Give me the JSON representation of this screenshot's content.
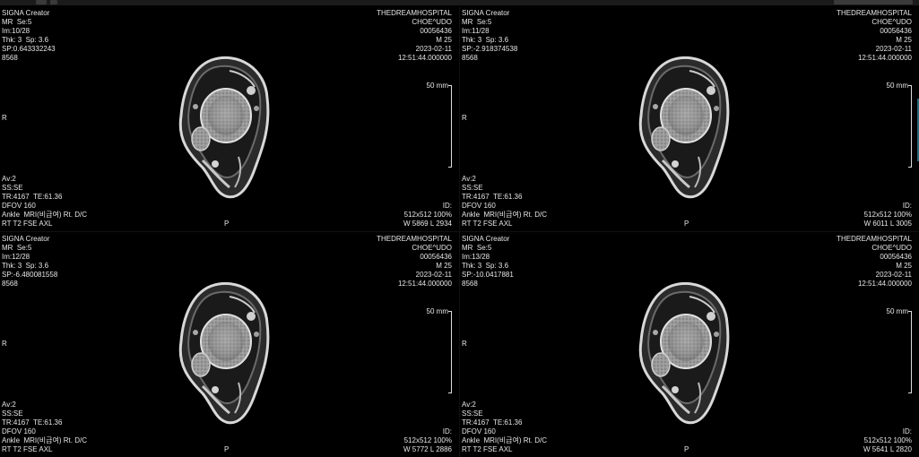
{
  "viewports": [
    {
      "header_left": [
        "SIGNA Creator",
        "MR  Se:5",
        "Im:10/28",
        "Thk: 3  Sp: 3.6",
        "SP:0.643332243",
        "8568"
      ],
      "header_right": [
        "THEDREAMHOSPITAL",
        "CHOE^UDO",
        "00056436",
        "M 25",
        "2023-02-11",
        "12:51:44.000000"
      ],
      "footer_left": [
        "Av:2",
        "SS:SE",
        "TR:4167  TE:61.36",
        "DFOV 160",
        "Ankle  MRI(비급여) Rt. D/C",
        "RT T2 FSE AXL"
      ],
      "footer_right": [
        "ID:",
        "512x512 100%",
        "W 5869 L 2934"
      ],
      "orient_side": "R",
      "orient_bottom": "P",
      "scale_label": "50 mm"
    },
    {
      "header_left": [
        "SIGNA Creator",
        "MR  Se:5",
        "Im:11/28",
        "Thk: 3  Sp: 3.6",
        "SP:-2.918374538",
        "8568"
      ],
      "header_right": [
        "THEDREAMHOSPITAL",
        "CHOE^UDO",
        "00056436",
        "M 25",
        "2023-02-11",
        "12:51:44.000000"
      ],
      "footer_left": [
        "Av:2",
        "SS:SE",
        "TR:4167  TE:61.36",
        "DFOV 160",
        "Ankle  MRI(비급여) Rt. D/C",
        "RT T2 FSE AXL"
      ],
      "footer_right": [
        "ID:",
        "512x512 100%",
        "W 6011 L 3005"
      ],
      "orient_side": "R",
      "orient_bottom": "P",
      "scale_label": "50 mm"
    },
    {
      "header_left": [
        "SIGNA Creator",
        "MR  Se:5",
        "Im:12/28",
        "Thk: 3  Sp: 3.6",
        "SP:-6.480081558",
        "8568"
      ],
      "header_right": [
        "THEDREAMHOSPITAL",
        "CHOE^UDO",
        "00056436",
        "M 25",
        "2023-02-11",
        "12:51:44.000000"
      ],
      "footer_left": [
        "Av:2",
        "SS:SE",
        "TR:4167  TE:61.36",
        "DFOV 160",
        "Ankle  MRI(비급여) Rt. D/C",
        "RT T2 FSE AXL"
      ],
      "footer_right": [
        "ID:",
        "512x512 100%",
        "W 5772 L 2886"
      ],
      "orient_side": "R",
      "orient_bottom": "P",
      "scale_label": "50 mm"
    },
    {
      "header_left": [
        "SIGNA Creator",
        "MR  Se:5",
        "Im:13/28",
        "Thk: 3  Sp: 3.6",
        "SP:-10.0417881",
        "8568"
      ],
      "header_right": [
        "THEDREAMHOSPITAL",
        "CHOE^UDO",
        "00056436",
        "M 25",
        "2023-02-11",
        "12:51:44.000000"
      ],
      "footer_left": [
        "Av:2",
        "SS:SE",
        "TR:4167  TE:61.36",
        "DFOV 160",
        "Ankle  MRI(비급여) Rt. D/C",
        "RT T2 FSE AXL"
      ],
      "footer_right": [
        "ID:",
        "512x512 100%",
        "W 5641 L 2820"
      ],
      "orient_side": "R",
      "orient_bottom": "P",
      "scale_label": "50 mm"
    }
  ]
}
